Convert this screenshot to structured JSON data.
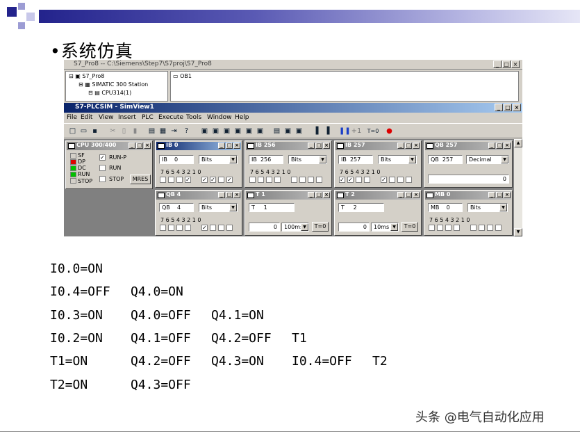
{
  "slide": {
    "title": "•系统仿真",
    "watermark": "头条 @电气自动化应用",
    "accent_colors": [
      "#23238c",
      "#5a5ab4",
      "#9c9cd4"
    ],
    "lines": [
      {
        "items": [
          "I0.0=ON"
        ]
      },
      {
        "items": [
          "I0.4=OFF",
          "Q4.0=ON"
        ]
      },
      {
        "items": [
          "I0.3=ON",
          "Q4.0=OFF",
          "Q4.1=ON"
        ]
      },
      {
        "items": [
          "I0.2=ON",
          "Q4.1=OFF",
          "Q4.2=OFF",
          "T1"
        ]
      },
      {
        "items": [
          "T1=ON",
          "Q4.2=OFF",
          "Q4.3=ON",
          "I0.4=OFF",
          "T2"
        ]
      },
      {
        "items": [
          "T2=ON",
          "Q4.3=OFF"
        ]
      }
    ]
  },
  "s7": {
    "window_title": "S7_Pro8 -- C:\\Siemens\\Step7\\S7proj\\S7_Pro8",
    "tree": [
      "S7_Pro8",
      "SIMATIC 300 Station",
      "CPU314(1)"
    ],
    "block": "OB1"
  },
  "plcsim": {
    "window_title": "S7-PLCSIM - SimView1",
    "menu": [
      "File",
      "Edit",
      "View",
      "Insert",
      "PLC",
      "Execute",
      "Tools",
      "Window",
      "Help"
    ],
    "toolbar_text": [
      "+1",
      "T=0"
    ],
    "cpu": {
      "title": "CPU 300/400",
      "leds": [
        {
          "label": "SF",
          "color": "#ffffff"
        },
        {
          "label": "DP",
          "color": "#e00000"
        },
        {
          "label": "DC",
          "color": "#00c000"
        },
        {
          "label": "RUN",
          "color": "#00c000"
        },
        {
          "label": "STOP",
          "color": "#ffffff"
        }
      ],
      "modes": [
        "RUN-P",
        "RUN",
        "STOP"
      ],
      "mres": "MRES"
    },
    "bit_header": "7 6 5 4   3 2 1 0",
    "ib0": {
      "title": "IB   0",
      "area": "IB",
      "addr": "0",
      "fmt": "Bits"
    },
    "ib256": {
      "title": "IB  256",
      "area": "IB",
      "addr": "256",
      "fmt": "Bits"
    },
    "ib257": {
      "title": "IB  257",
      "area": "IB",
      "addr": "257",
      "fmt": "Bits"
    },
    "qb257": {
      "title": "QB  257",
      "area": "QB",
      "addr": "257",
      "fmt": "Decimal",
      "value": "0"
    },
    "qb4": {
      "title": "QB   4",
      "area": "QB",
      "addr": "4",
      "fmt": "Bits"
    },
    "t1": {
      "title": "T   1",
      "area": "T",
      "addr": "1",
      "value": "0",
      "base": "100ms",
      "reset": "T=0"
    },
    "t2": {
      "title": "T   2",
      "area": "T",
      "addr": "2",
      "value": "0",
      "base": "10ms",
      "reset": "T=0"
    },
    "mb0": {
      "title": "MB   0",
      "area": "MB",
      "addr": "0",
      "fmt": "Bits"
    }
  }
}
